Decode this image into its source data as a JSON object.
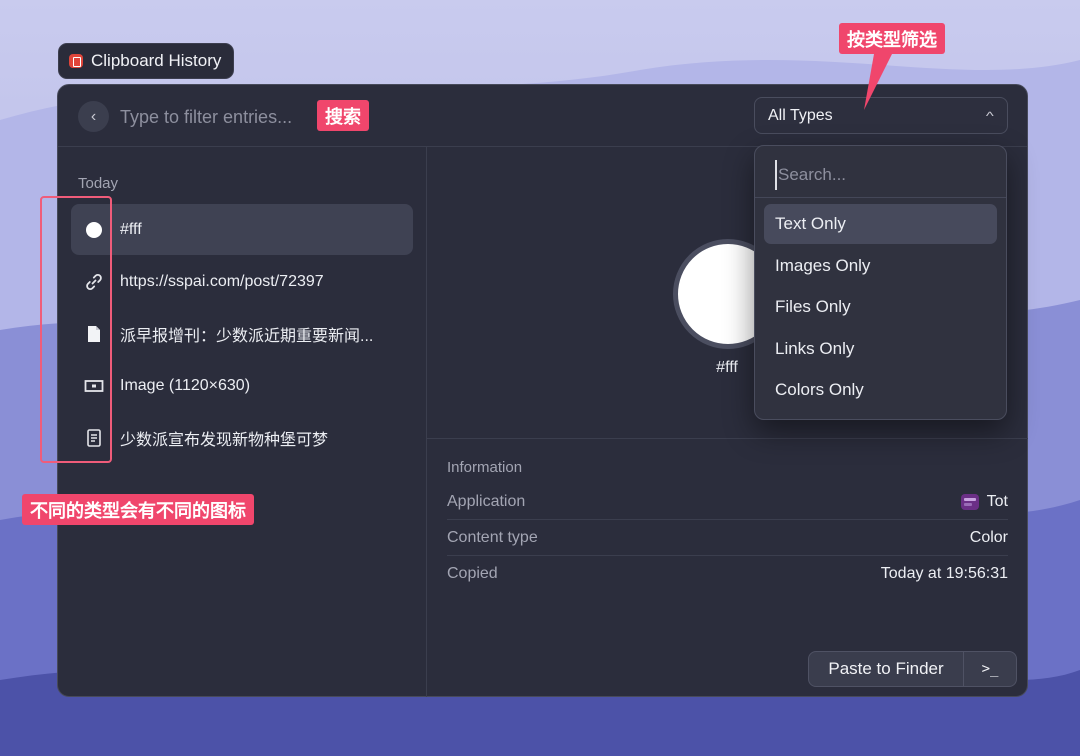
{
  "app": {
    "title": "Clipboard History"
  },
  "search": {
    "placeholder": "Type to filter entries..."
  },
  "type_filter": {
    "selected": "All Types",
    "search_placeholder": "Search...",
    "options": [
      "Text Only",
      "Images Only",
      "Files Only",
      "Links Only",
      "Colors Only"
    ]
  },
  "history": {
    "section": "Today",
    "entries": [
      {
        "icon": "color-circle-icon",
        "text": "#fff"
      },
      {
        "icon": "link-icon",
        "text": "https://sspai.com/post/72397"
      },
      {
        "icon": "file-icon",
        "text": "派早报增刊：少数派近期重要新闻..."
      },
      {
        "icon": "image-icon",
        "text": "Image (1120×630)"
      },
      {
        "icon": "text-document-icon",
        "text": "少数派宣布发现新物种堡可梦"
      }
    ]
  },
  "preview": {
    "label": "#fff",
    "color": "#ffffff"
  },
  "information": {
    "title": "Information",
    "rows": [
      {
        "key": "Application",
        "value": "Tot",
        "icon": "tot-app-icon"
      },
      {
        "key": "Content type",
        "value": "Color"
      },
      {
        "key": "Copied",
        "value": "Today at 19:56:31"
      }
    ]
  },
  "actions": {
    "paste_label": "Paste to Finder",
    "terminal_label": ">_"
  },
  "annotations": {
    "search_tag": "搜索",
    "filter_tag": "按类型筛选",
    "icons_tag": "不同的类型会有不同的图标"
  },
  "colors": {
    "accent_annotation": "#f0466c",
    "window_bg": "#2b2d3c",
    "selected_row": "#3f4253"
  }
}
